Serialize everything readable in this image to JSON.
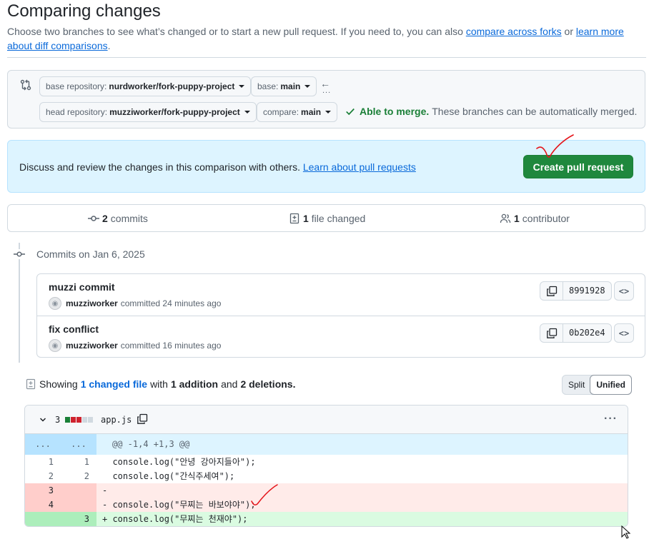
{
  "page": {
    "title": "Comparing changes",
    "subtitle_prefix": "Choose two branches to see what’s changed or to start a new pull request. If you need to, you can also",
    "link_compare_forks": "compare across forks",
    "subtitle_or": "or",
    "link_learn_more": "learn more about diff comparisons",
    "subtitle_end": "."
  },
  "range": {
    "base_repo_label": "base repository:",
    "base_repo_value": "nurdworker/fork-puppy-project",
    "base_label": "base:",
    "base_value": "main",
    "head_repo_label": "head repository:",
    "head_repo_value": "muzziworker/fork-puppy-project",
    "compare_label": "compare:",
    "compare_value": "main",
    "swap_arrow": "←",
    "swap_dots": "...",
    "merge_ok": "Able to merge.",
    "merge_msg": "These branches can be automatically merged."
  },
  "discuss": {
    "text": "Discuss and review the changes in this comparison with others.",
    "link": "Learn about pull requests",
    "button": "Create pull request"
  },
  "stats": {
    "commits_count": "2",
    "commits_label": "commits",
    "files_count": "1",
    "files_label": "file changed",
    "contributors_count": "1",
    "contributors_label": "contributor"
  },
  "commits": {
    "heading": "Commits on Jan 6, 2025",
    "items": [
      {
        "title": "muzzi commit",
        "author": "muzziworker",
        "action": "committed",
        "time": "24 minutes ago",
        "sha": "8991928",
        "browse": "<>"
      },
      {
        "title": "fix conflict",
        "author": "muzziworker",
        "action": "committed",
        "time": "16 minutes ago",
        "sha": "0b202e4",
        "browse": "<>"
      }
    ]
  },
  "summary": {
    "showing": "Showing",
    "changed": "1 changed file",
    "with": "with",
    "additions": "1 addition",
    "and": "and",
    "deletions": "2 deletions.",
    "split": "Split",
    "unified": "Unified"
  },
  "diff": {
    "change_count": "3",
    "filename": "app.js",
    "kebab": "···",
    "hunk_ln": "...",
    "hunk": "@@ -1,4 +1,3 @@",
    "lines": [
      {
        "old": "1",
        "new": "1",
        "code": "  console.log(\"안녕 강아지들아\");"
      },
      {
        "old": "2",
        "new": "2",
        "code": "  console.log(\"간식주세여\");"
      },
      {
        "old": "3",
        "new": "",
        "code": "-"
      },
      {
        "old": "4",
        "new": "",
        "code": "- console.log(\"무찌는 바보야야\");"
      },
      {
        "old": "",
        "new": "3",
        "code": "+ console.log(\"무찌는 천재야\");"
      }
    ]
  },
  "colors": {
    "accent": "#0969da",
    "success": "#1f883d",
    "deletion": "#ffebe9",
    "addition": "#dafbe1",
    "annotation": "#e5141a"
  },
  "icons": [
    "git-compare-icon",
    "caret-down-icon",
    "check-icon",
    "commit-icon",
    "file-diff-icon",
    "people-icon",
    "copy-icon",
    "code-icon",
    "chevron-down-icon",
    "kebab-icon",
    "avatar-icon",
    "cursor-icon"
  ]
}
